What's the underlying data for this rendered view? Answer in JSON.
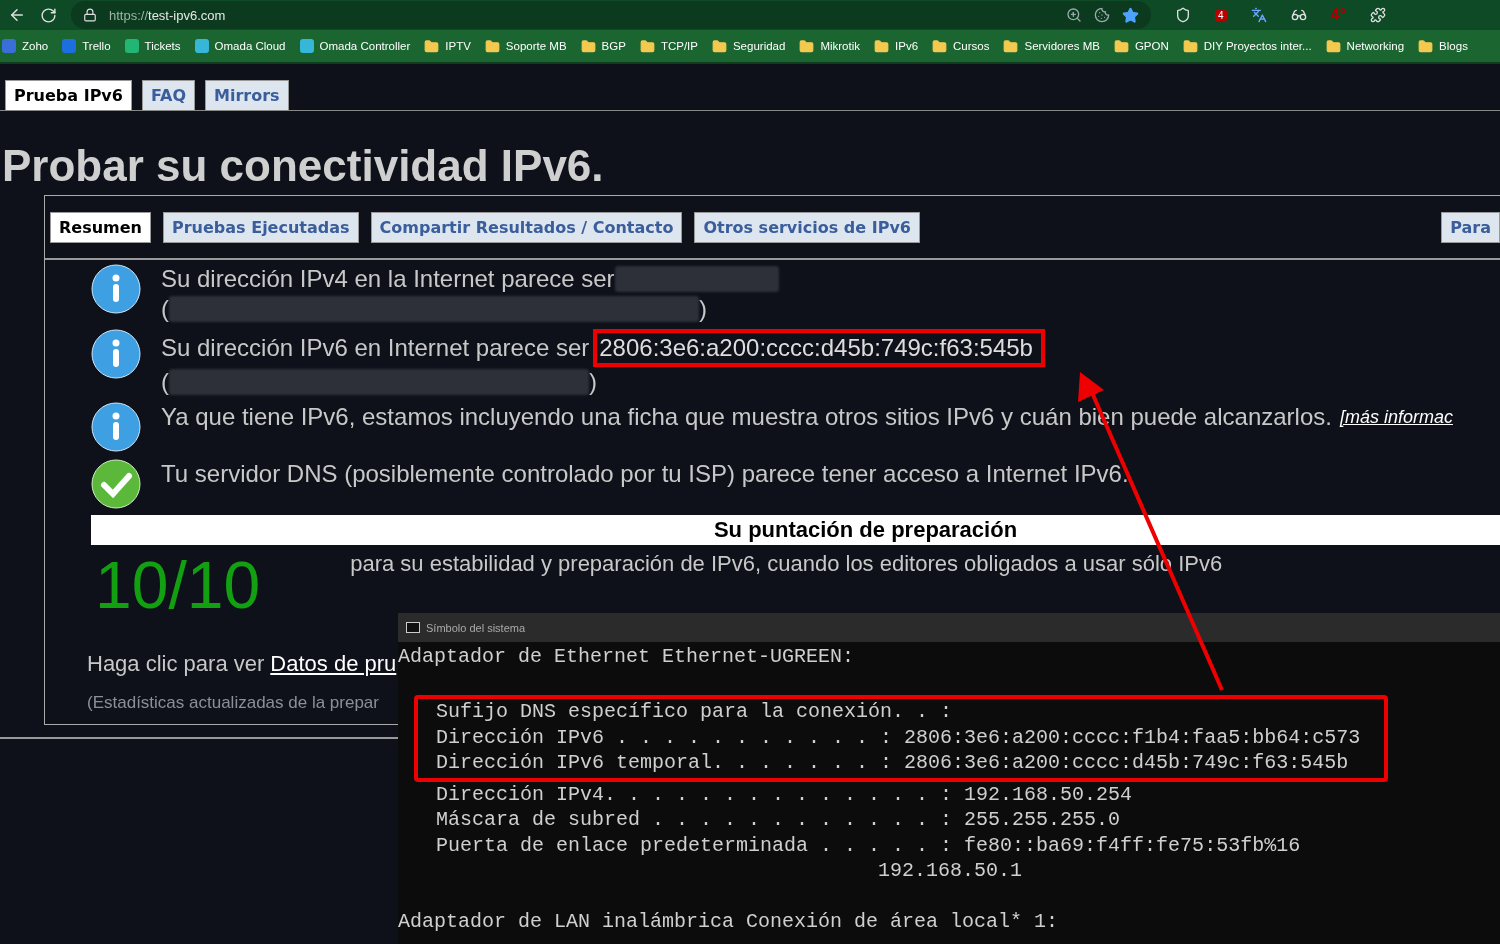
{
  "browser": {
    "url_scheme": "https://",
    "url_host": "test-ipv6.com",
    "extension_badge": "4",
    "extension_label": "4°"
  },
  "bookmarks": [
    {
      "kind": "site",
      "label": "Zoho"
    },
    {
      "kind": "site",
      "label": "Trello"
    },
    {
      "kind": "site",
      "label": "Tickets"
    },
    {
      "kind": "site",
      "label": "Omada Cloud"
    },
    {
      "kind": "site",
      "label": "Omada Controller"
    },
    {
      "kind": "folder",
      "label": "IPTV"
    },
    {
      "kind": "folder",
      "label": "Soporte MB"
    },
    {
      "kind": "folder",
      "label": "BGP"
    },
    {
      "kind": "folder",
      "label": "TCP/IP"
    },
    {
      "kind": "folder",
      "label": "Seguridad"
    },
    {
      "kind": "folder",
      "label": "Mikrotik"
    },
    {
      "kind": "folder",
      "label": "IPv6"
    },
    {
      "kind": "folder",
      "label": "Cursos"
    },
    {
      "kind": "folder",
      "label": "Servidores MB"
    },
    {
      "kind": "folder",
      "label": "GPON"
    },
    {
      "kind": "folder",
      "label": "DIY Proyectos inter..."
    },
    {
      "kind": "folder",
      "label": "Networking"
    },
    {
      "kind": "folder",
      "label": "Blogs"
    }
  ],
  "site_tabs": [
    {
      "label": "Prueba IPv6",
      "selected": true
    },
    {
      "label": "FAQ",
      "selected": false
    },
    {
      "label": "Mirrors",
      "selected": false
    }
  ],
  "title": "Probar su conectividad IPv6.",
  "panel_tabs": [
    {
      "label": "Resumen",
      "selected": true
    },
    {
      "label": "Pruebas Ejecutadas",
      "selected": false
    },
    {
      "label": "Compartir Resultados / Contacto",
      "selected": false
    },
    {
      "label": "Otros servicios de IPv6",
      "selected": false
    },
    {
      "label": "Para",
      "selected": false
    }
  ],
  "messages": [
    {
      "kind": "hidden",
      "text": "Su dirección IPv4 en la Internet parece ser",
      "open": "(",
      "close": ")"
    },
    {
      "kind": "address",
      "text": "Su dirección IPv6 en Internet parece ser",
      "address": "2806:3e6:a200:cccc:d45b:749c:f63:545b",
      "open": "(",
      "close": ")"
    },
    {
      "kind": "info",
      "text": "Ya que tiene IPv6, estamos incluyendo una ficha que muestra otros sitios IPv6 y cuán bien puede alcanzarlos.",
      "link": "[más informac"
    },
    {
      "kind": "ok",
      "text": "Tu servidor DNS (posiblemente controlado por tu ISP) parece tener acceso a Internet IPv6."
    }
  ],
  "score": {
    "heading": "Su puntación de preparación",
    "value": "10/10",
    "description": "para su estabilidad y preparación de IPv6, cuando los editores obligados a usar sólo IPv6"
  },
  "details": {
    "text": "Haga clic para ver",
    "link": "Datos de pru"
  },
  "stats": "(Estadísticas actualizadas de la prepar",
  "terminal": {
    "title": "Símbolo del sistema",
    "lines": [
      {
        "kind": "adapter",
        "text": "Adaptador de Ethernet Ethernet-UGREEN:"
      },
      {
        "kind": "blank"
      },
      {
        "kind": "marked",
        "text": "Sufijo DNS específico para la conexión. . :"
      },
      {
        "kind": "marked",
        "text": "Dirección IPv6 . . . . . . . . . . . : 2806:3e6:a200:cccc:f1b4:faa5:bb64:c573"
      },
      {
        "kind": "marked",
        "text": "Dirección IPv6 temporal. . . . . . . : 2806:3e6:a200:cccc:d45b:749c:f63:545b"
      },
      {
        "kind": "entry",
        "text": "Dirección IPv4. . . . . . . . . . . . . . : 192.168.50.254"
      },
      {
        "kind": "entry",
        "text": "Máscara de subred . . . . . . . . . . . . : 255.255.255.0"
      },
      {
        "kind": "entry",
        "text": "Puerta de enlace predeterminada . . . . . : fe80::ba69:f4ff:fe75:53fb%16"
      },
      {
        "kind": "continuation",
        "text": "192.168.50.1"
      },
      {
        "kind": "blank"
      },
      {
        "kind": "adapter",
        "text": "Adaptador de LAN inalámbrica Conexión de área local* 1:"
      }
    ]
  }
}
